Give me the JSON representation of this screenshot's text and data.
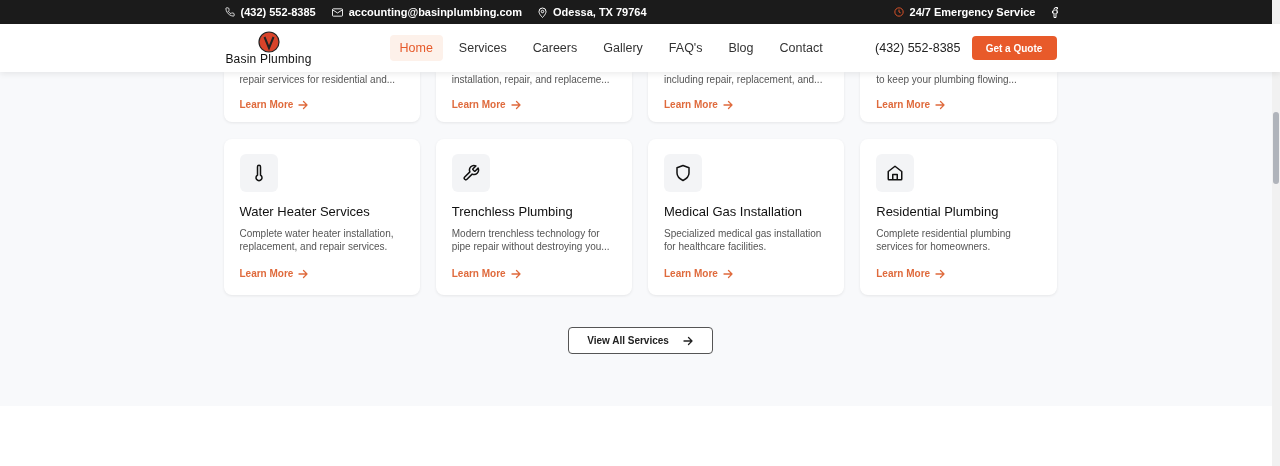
{
  "top_bar": {
    "phone": "(432) 552-8385",
    "email": "accounting@basinplumbing.com",
    "location": "Odessa, TX 79764",
    "emergency": "24/7 Emergency Service"
  },
  "header": {
    "logo_text": "Basin Plumbing",
    "nav": [
      {
        "label": "Home",
        "selected": true
      },
      {
        "label": "Services",
        "selected": false
      },
      {
        "label": "Careers",
        "selected": false
      },
      {
        "label": "Gallery",
        "selected": false
      },
      {
        "label": "FAQ's",
        "selected": false
      },
      {
        "label": "Blog",
        "selected": false
      },
      {
        "label": "Contact",
        "selected": false
      }
    ],
    "phone": "(432) 552-8385",
    "cta": "Get a Quote"
  },
  "services_partial": [
    {
      "description": "repair services for residential and...",
      "link": "Learn More"
    },
    {
      "description": "installation, repair, and replaceme...",
      "link": "Learn More"
    },
    {
      "description": "including repair, replacement, and...",
      "link": "Learn More"
    },
    {
      "description": "to keep your plumbing flowing...",
      "link": "Learn More"
    }
  ],
  "services": [
    {
      "kind": "thermometer",
      "title": "Water Heater Services",
      "description": "Complete water heater installation, replacement, and repair services.",
      "link": "Learn More"
    },
    {
      "kind": "wrench",
      "title": "Trenchless Plumbing",
      "description": "Modern trenchless technology for pipe repair without destroying you...",
      "link": "Learn More"
    },
    {
      "kind": "shield",
      "title": "Medical Gas Installation",
      "description": "Specialized medical gas installation for healthcare facilities.",
      "link": "Learn More"
    },
    {
      "kind": "house",
      "title": "Residential Plumbing",
      "description": "Complete residential plumbing services for homeowners.",
      "link": "Learn More"
    }
  ],
  "view_all": "View All Services"
}
